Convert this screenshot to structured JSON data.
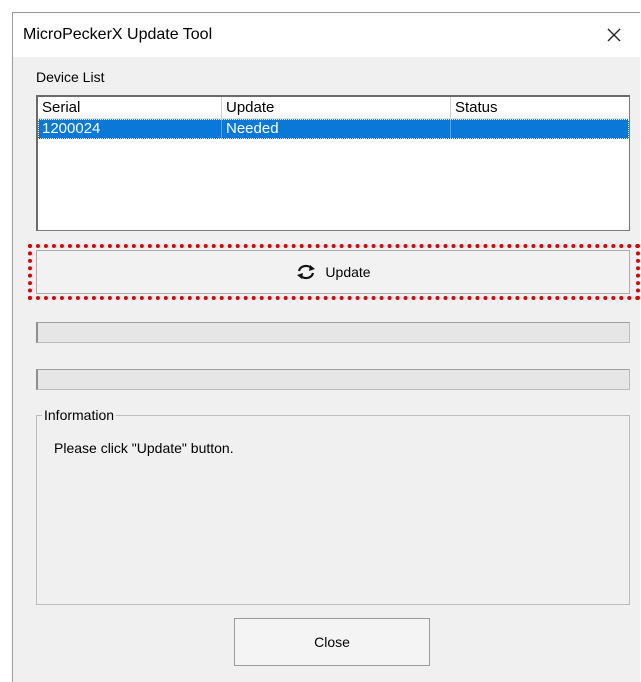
{
  "window": {
    "title": "MicroPeckerX Update Tool"
  },
  "device_list": {
    "label": "Device List",
    "columns": [
      "Serial",
      "Update",
      "Status"
    ],
    "rows": [
      {
        "serial": "1200024",
        "update": "Needed",
        "status": ""
      }
    ]
  },
  "update_button": {
    "label": "Update",
    "icon": "refresh-icon"
  },
  "progress": {
    "bar1": 0,
    "bar2": 0
  },
  "information": {
    "legend": "Information",
    "message": "Please click \"Update\" button."
  },
  "close_button": {
    "label": "Close"
  },
  "colors": {
    "selection": "#0a78d7",
    "highlight_frame": "#e00000"
  }
}
